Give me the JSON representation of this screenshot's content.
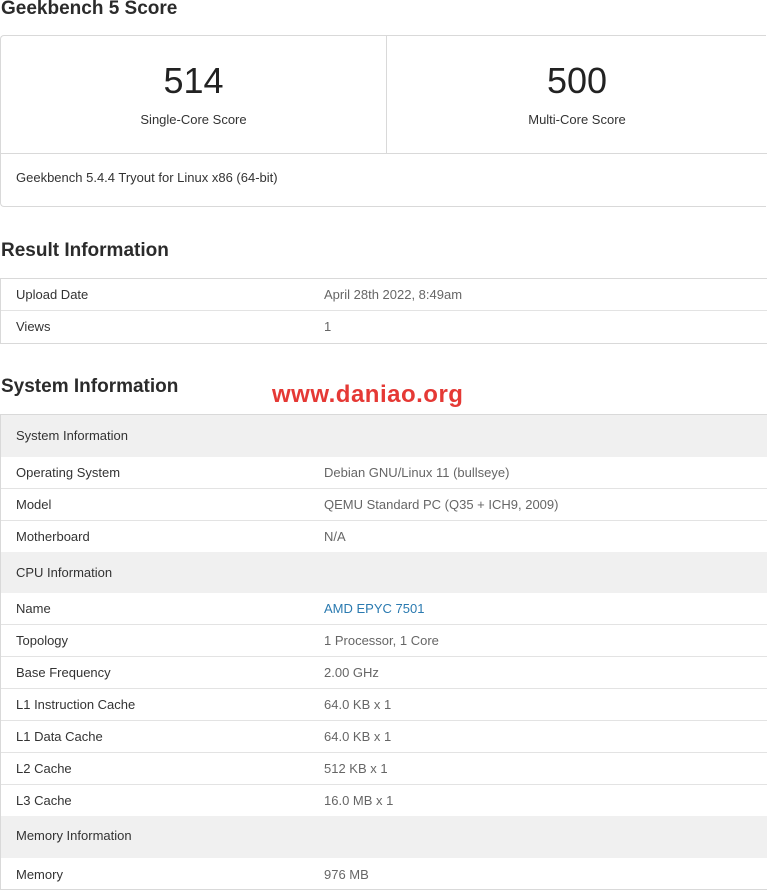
{
  "score_section": {
    "title": "Geekbench 5 Score",
    "single_core": {
      "value": "514",
      "label": "Single-Core Score"
    },
    "multi_core": {
      "value": "500",
      "label": "Multi-Core Score"
    },
    "version": "Geekbench 5.4.4 Tryout for Linux x86 (64-bit)"
  },
  "result_info": {
    "title": "Result Information",
    "rows": [
      {
        "key": "Upload Date",
        "value": "April 28th 2022, 8:49am"
      },
      {
        "key": "Views",
        "value": "1"
      }
    ]
  },
  "system_info": {
    "title": "System Information",
    "watermark": "www.daniao.org",
    "sections": [
      {
        "header": "System Information",
        "rows": [
          {
            "key": "Operating System",
            "value": "Debian GNU/Linux 11 (bullseye)"
          },
          {
            "key": "Model",
            "value": "QEMU Standard PC (Q35 + ICH9, 2009)"
          },
          {
            "key": "Motherboard",
            "value": "N/A"
          }
        ]
      },
      {
        "header": "CPU Information",
        "rows": [
          {
            "key": "Name",
            "value": "AMD EPYC 7501"
          },
          {
            "key": "Topology",
            "value": "1 Processor, 1 Core"
          },
          {
            "key": "Base Frequency",
            "value": "2.00 GHz"
          },
          {
            "key": "L1 Instruction Cache",
            "value": "64.0 KB x 1"
          },
          {
            "key": "L1 Data Cache",
            "value": "64.0 KB x 1"
          },
          {
            "key": "L2 Cache",
            "value": "512 KB x 1"
          },
          {
            "key": "L3 Cache",
            "value": "16.0 MB x 1"
          }
        ]
      },
      {
        "header": "Memory Information",
        "rows": [
          {
            "key": "Memory",
            "value": "976 MB"
          }
        ]
      }
    ]
  },
  "colors": {
    "link": "#2a7ab0",
    "watermark": "#e53935",
    "section_bg": "#f0f0f0"
  }
}
